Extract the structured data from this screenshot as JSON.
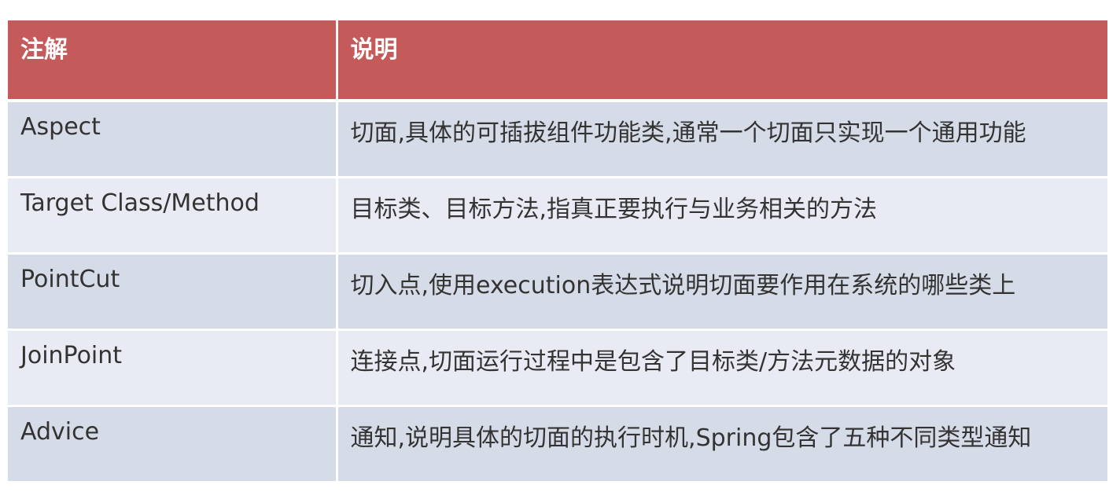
{
  "table": {
    "headers": [
      "注解",
      "说明"
    ],
    "rows": [
      {
        "annotation": "Aspect",
        "description": "切面,具体的可插拔组件功能类,通常一个切面只实现一个通用功能"
      },
      {
        "annotation": "Target Class/Method",
        "description": "目标类、目标方法,指真正要执行与业务相关的方法"
      },
      {
        "annotation": "PointCut",
        "description": "切入点,使用execution表达式说明切面要作用在系统的哪些类上"
      },
      {
        "annotation": "JoinPoint",
        "description": "连接点,切面运行过程中是包含了目标类/方法元数据的对象"
      },
      {
        "annotation": "Advice",
        "description": "通知,说明具体的切面的执行时机,Spring包含了五种不同类型通知"
      }
    ]
  },
  "colors": {
    "header_bg": "#c55a5a",
    "row_bg": "#d6dbe8",
    "row_alt_bg": "#e8ebf3"
  }
}
